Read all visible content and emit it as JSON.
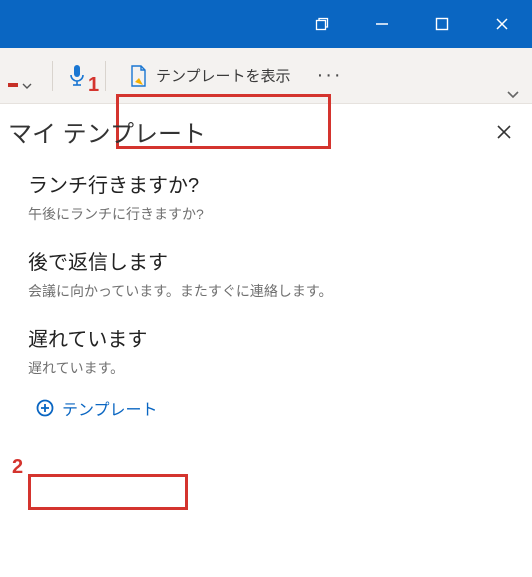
{
  "colors": {
    "titlebar": "#0a66c2",
    "ribbon_bg": "#f4f2f0",
    "accent_red": "#d4342e",
    "link_blue": "#0a66c2"
  },
  "titlebar": {
    "restore_icon": "restore-window",
    "minimize_icon": "minimize",
    "maximize_icon": "maximize",
    "close_icon": "close"
  },
  "ribbon": {
    "dictate_icon": "microphone",
    "template_button_label": "テンプレートを表示",
    "more_label": "···"
  },
  "pane": {
    "title": "マイ テンプレート",
    "templates": [
      {
        "title": "ランチ行きますか?",
        "body": "午後にランチに行きますか?"
      },
      {
        "title": "後で返信します",
        "body": "会議に向かっています。またすぐに連絡します。"
      },
      {
        "title": "遅れています",
        "body": "遅れています。"
      }
    ],
    "add_template_label": "テンプレート"
  },
  "callouts": {
    "one": "1",
    "two": "2"
  }
}
